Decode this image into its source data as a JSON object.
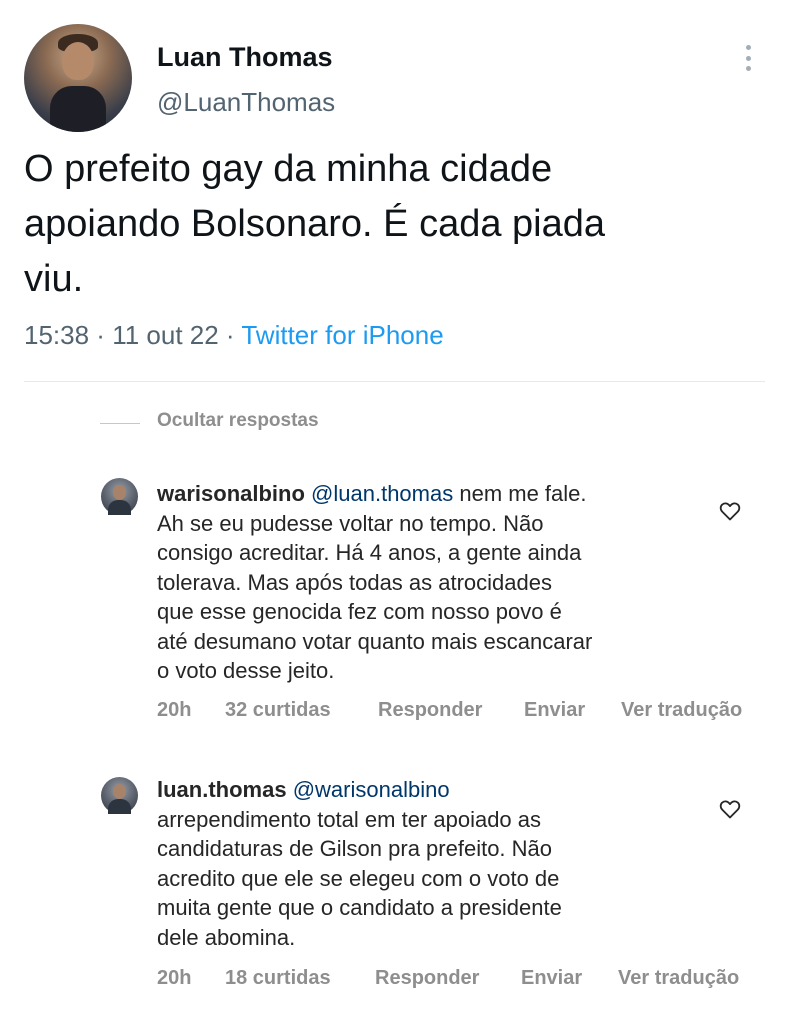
{
  "tweet": {
    "author_name": "Luan Thomas",
    "author_handle": "@LuanThomas",
    "text_lines": [
      "O prefeito gay da minha cidade",
      "apoiando Bolsonaro. É cada piada",
      "viu."
    ],
    "time": "15:38",
    "separator": " · ",
    "date": "11 out 22",
    "source": "Twitter for iPhone",
    "more_icon": "more-vertical-icon"
  },
  "replies": {
    "hide_label": "Ocultar respostas",
    "comments": [
      {
        "username": "warisonalbino",
        "mention": "@luan.thomas",
        "first_line_rest": " nem me fale.",
        "lines": [
          "Ah se eu pudesse voltar no tempo. Não",
          "consigo acreditar. Há 4 anos, a gente ainda",
          "tolerava. Mas após todas as atrocidades",
          "que esse genocida fez com nosso povo é",
          "até desumano votar quanto mais escancarar",
          "o voto desse jeito."
        ],
        "time": "20h",
        "likes": "32 curtidas",
        "reply": "Responder",
        "send": "Enviar",
        "translate": "Ver tradução"
      },
      {
        "username": "luan.thomas",
        "mention": "@warisonalbino",
        "first_line_rest": "",
        "lines": [
          "arrependimento total em ter apoiado as",
          "candidaturas de Gilson pra prefeito. Não",
          "acredito que ele se elegeu com o voto de",
          "muita gente que o candidato a presidente",
          "dele abomina."
        ],
        "time": "20h",
        "likes": "18 curtidas",
        "reply": "Responder",
        "send": "Enviar",
        "translate": "Ver tradução"
      }
    ]
  },
  "colors": {
    "text": "#0f1419",
    "secondary": "#536471",
    "link": "#1d9bf0",
    "mention": "#00376b",
    "muted": "#8e8e8e"
  }
}
